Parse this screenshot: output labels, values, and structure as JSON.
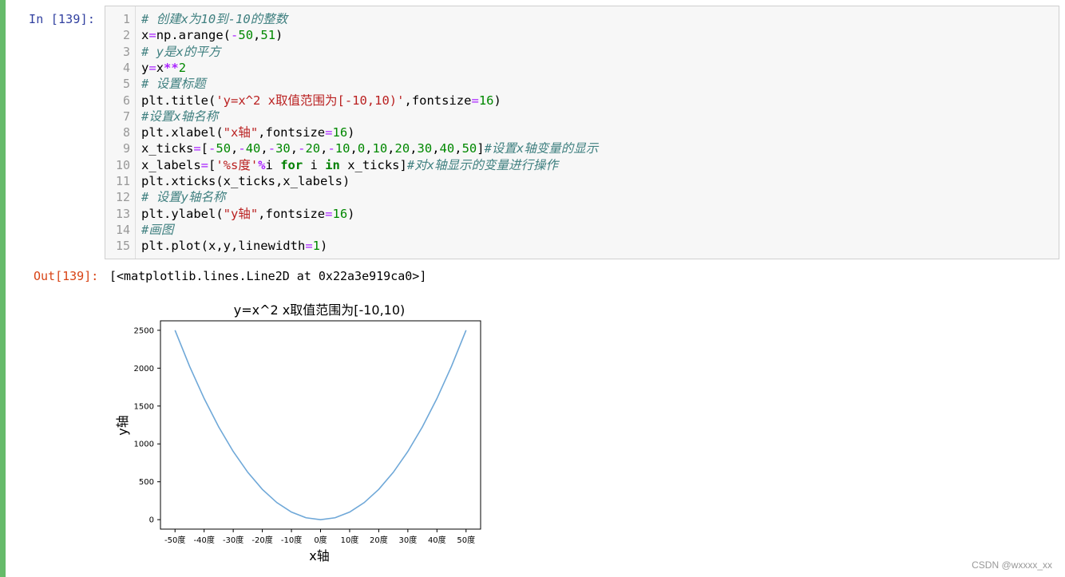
{
  "cell": {
    "in_prompt": "In [139]:",
    "out_prompt": "Out[139]:",
    "output_text": "[<matplotlib.lines.Line2D at 0x22a3e919ca0>]",
    "lines": [
      "# 创建x为10到-10的整数",
      "x=np.arange(-50,51)",
      "# y是x的平方",
      "y=x**2",
      "# 设置标题",
      "plt.title('y=x^2 x取值范围为[-10,10)',fontsize=16)",
      "#设置x轴名称",
      "plt.xlabel(\"x轴\",fontsize=16)",
      "x_ticks=[-50,-40,-30,-20,-10,0,10,20,30,40,50]#设置x轴变量的显示",
      "x_labels=['%s度'%i for i in x_ticks]#对x轴显示的变量进行操作",
      "plt.xticks(x_ticks,x_labels)",
      "# 设置y轴名称",
      "plt.ylabel(\"y轴\",fontsize=16)",
      "#画图",
      "plt.plot(x,y,linewidth=1)"
    ]
  },
  "chart_data": {
    "type": "line",
    "title": "y=x^2 x取值范围为[-10,10)",
    "xlabel": "x轴",
    "ylabel": "y轴",
    "x_tick_values": [
      -50,
      -40,
      -30,
      -20,
      -10,
      0,
      10,
      20,
      30,
      40,
      50
    ],
    "x_tick_labels": [
      "-50度",
      "-40度",
      "-30度",
      "-20度",
      "-10度",
      "0度",
      "10度",
      "20度",
      "30度",
      "40度",
      "50度"
    ],
    "y_tick_values": [
      0,
      500,
      1000,
      1500,
      2000,
      2500
    ],
    "y_tick_labels": [
      "0",
      "500",
      "1000",
      "1500",
      "2000",
      "2500"
    ],
    "xlim": [
      -55,
      55
    ],
    "ylim": [
      -125,
      2625
    ],
    "series": [
      {
        "color": "#6fa8d8",
        "x": [
          -50,
          -45,
          -40,
          -35,
          -30,
          -25,
          -20,
          -15,
          -10,
          -5,
          0,
          5,
          10,
          15,
          20,
          25,
          30,
          35,
          40,
          45,
          50
        ],
        "y": [
          2500,
          2025,
          1600,
          1225,
          900,
          625,
          400,
          225,
          100,
          25,
          0,
          25,
          100,
          225,
          400,
          625,
          900,
          1225,
          1600,
          2025,
          2500
        ]
      }
    ]
  },
  "watermark": "CSDN @wxxxx_xx"
}
